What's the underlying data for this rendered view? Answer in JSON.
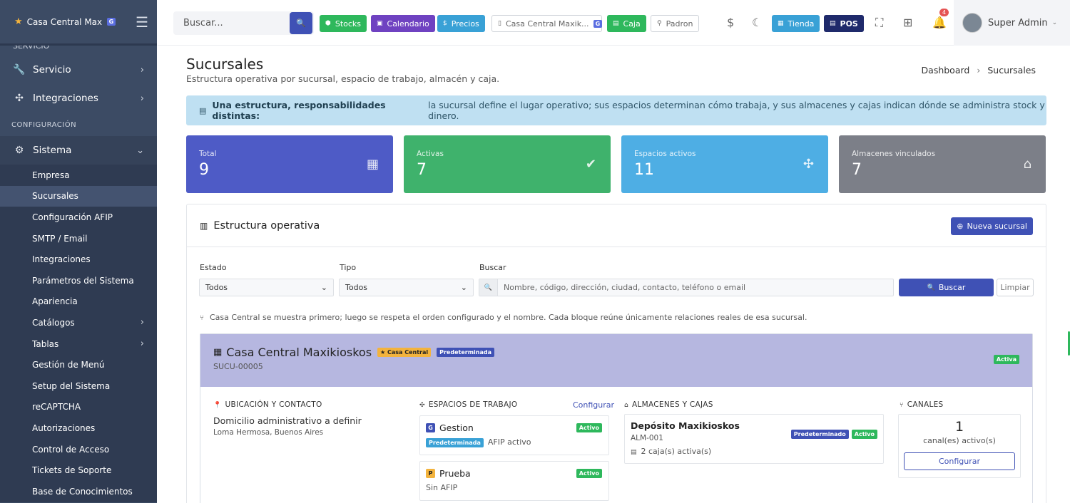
{
  "sidebar": {
    "brand": "Casa Central Maxikioskos",
    "brand_badge": "G",
    "cut_item": "SERVICIO",
    "items": [
      {
        "label": "Servicio"
      },
      {
        "label": "Integraciones"
      }
    ],
    "section_label": "CONFIGURACIÓN",
    "sistema_label": "Sistema",
    "subitems": [
      "Empresa",
      "Sucursales",
      "Configuración AFIP",
      "SMTP / Email",
      "Integraciones",
      "Parámetros del Sistema",
      "Apariencia",
      "Catálogos",
      "Tablas",
      "Gestión de Menú",
      "Setup del Sistema",
      "reCAPTCHA",
      "Autorizaciones",
      "Control de Acceso",
      "Tickets de Soporte",
      "Base de Conocimientos"
    ],
    "active_subitem": "Sucursales"
  },
  "topbar": {
    "search_placeholder": "Buscar...",
    "buttons": {
      "stocks": "Stocks",
      "calendario": "Calendario",
      "precios": "Precios",
      "branch": "Casa Central Maxik...",
      "branch_badge": "G",
      "caja": "Caja",
      "padron": "Padron",
      "tienda": "Tienda",
      "pos": "POS"
    },
    "notifications_count": "4",
    "user_name": "Super Admin",
    "colors": {
      "stocks": "#2eb85c",
      "calendario": "#6f42c1",
      "precios": "#39a1d6",
      "caja": "#2eb85c",
      "tienda": "#39a1d6",
      "pos": "#1f2a6b"
    }
  },
  "page": {
    "title": "Sucursales",
    "subtitle": "Estructura operativa por sucursal, espacio de trabajo, almacén y caja.",
    "breadcrumb": [
      "Dashboard",
      "Sucursales"
    ]
  },
  "alert": {
    "bold": "Una estructura, responsabilidades distintas:",
    "text": "la sucursal define el lugar operativo; sus espacios determinan cómo trabaja, y sus almacenes y cajas indican dónde se administra stock y dinero."
  },
  "stats": [
    {
      "label": "Total",
      "value": "9",
      "icon": "store-icon",
      "color": "#4e5bc6"
    },
    {
      "label": "Activas",
      "value": "7",
      "icon": "check-circle-icon",
      "color": "#3fb26c"
    },
    {
      "label": "Espacios activos",
      "value": "11",
      "icon": "puzzle-icon",
      "color": "#4eaee4"
    },
    {
      "label": "Almacenes vinculados",
      "value": "7",
      "icon": "warehouse-icon",
      "color": "#7c7f88"
    }
  ],
  "panel": {
    "title": "Estructura operativa",
    "new_button": "Nueva sucursal",
    "filters": {
      "estado_label": "Estado",
      "estado_value": "Todos",
      "tipo_label": "Tipo",
      "tipo_value": "Todos",
      "buscar_label": "Buscar",
      "buscar_placeholder": "Nombre, código, dirección, ciudad, contacto, teléfono o email",
      "buscar_button": "Buscar",
      "limpiar_button": "Limpiar"
    },
    "note": "Casa Central se muestra primero; luego se respeta el orden configurado y el nombre. Cada bloque reúne únicamente relaciones reales de esa sucursal."
  },
  "branch": {
    "name": "Casa Central Maxikioskos",
    "tag_central": "Casa Central",
    "tag_default": "Predeterminada",
    "code": "SUCU-00005",
    "status": "Activa",
    "location": {
      "header": "UBICACIÓN Y CONTACTO",
      "line1": "Domicilio administrativo a definir",
      "line2": "Loma Hermosa, Buenos Aires"
    },
    "workspaces": {
      "header": "ESPACIOS DE TRABAJO",
      "config_link": "Configurar",
      "items": [
        {
          "letter": "G",
          "name": "Gestion",
          "status": "Activo",
          "tag": "Predeterminada",
          "sub": "AFIP activo"
        },
        {
          "letter": "P",
          "name": "Prueba",
          "status": "Activo",
          "sub": "Sin AFIP"
        }
      ]
    },
    "warehouses": {
      "header": "ALMACENES Y CAJAS",
      "name": "Depósito Maxikioskos",
      "code": "ALM-001",
      "tag_default": "Predeterminado",
      "status": "Activo",
      "cajas": "2 caja(s) activa(s)"
    },
    "channels": {
      "header": "CANALES",
      "count": "1",
      "label": "canal(es) activo(s)",
      "button": "Configurar"
    }
  }
}
